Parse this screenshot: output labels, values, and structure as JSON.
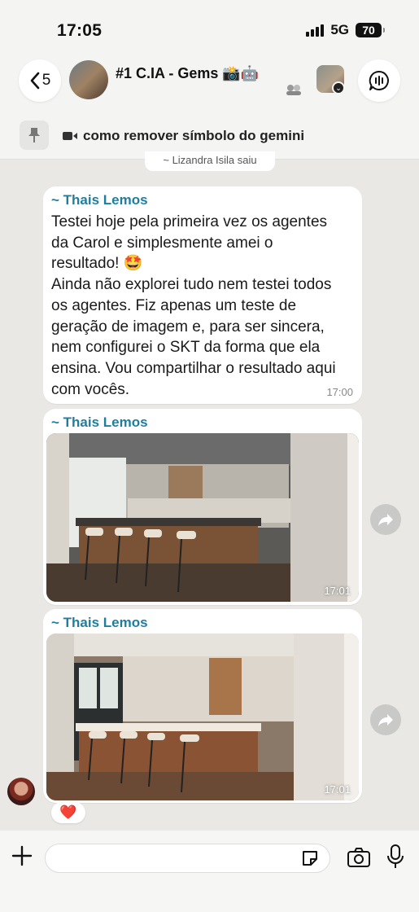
{
  "status_bar": {
    "time": "17:05",
    "network": "5G",
    "battery": "70"
  },
  "header": {
    "back_count": "5",
    "group_title": "#1 C.IA - Gems 📸🤖"
  },
  "pinned": {
    "text": "como remover símbolo do gemini"
  },
  "system_message": "~ Lizandra Isila saiu",
  "messages": [
    {
      "sender": "~ Thais Lemos",
      "text": "Testei hoje pela primeira vez os agentes\nda Carol e simplesmente amei o\nresultado! 🤩\nAinda não explorei tudo nem testei todos\nos agentes. Fiz apenas um teste de\ngeração de imagem e, para ser sincera,\nnem configurei o SKT da forma que ela\nensina. Vou compartilhar o resultado aqui\ncom vocês.",
      "time": "17:00"
    },
    {
      "sender": "~ Thais Lemos",
      "type": "image",
      "image_desc_icon": "kitchen-render-sketch",
      "time": "17:01"
    },
    {
      "sender": "~ Thais Lemos",
      "type": "image",
      "image_desc_icon": "kitchen-render-photo",
      "time": "17:01",
      "reaction": "❤️"
    }
  ],
  "composer": {
    "placeholder": ""
  },
  "colors": {
    "sender_name": "#1f7ea0",
    "background": "#e9e8e5",
    "bubble": "#ffffff",
    "reaction_heart": "#e0242c"
  }
}
